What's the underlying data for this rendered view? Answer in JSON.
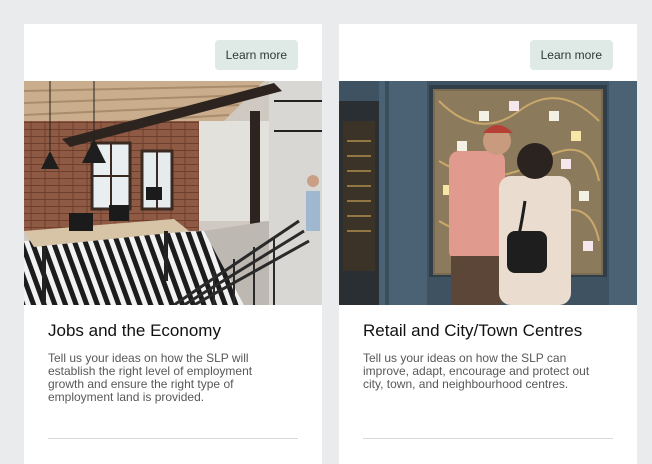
{
  "cards": [
    {
      "button_label": "Learn more",
      "image_subject": "office-interior-photo",
      "title": "Jobs and the Economy",
      "description": "Tell us your ideas on how the SLP will establish the right level of employment growth and ensure the right type of employment land is provided."
    },
    {
      "button_label": "Learn more",
      "image_subject": "couple-at-shop-window-photo",
      "title": "Retail and City/Town Centres",
      "description": "Tell us your ideas on how the SLP can improve, adapt, encourage and protect out city, town, and neighbourhood centres."
    }
  ],
  "colors": {
    "page_background": "#e9ebec",
    "card_background": "#ffffff",
    "button_background": "#dfe9e6"
  }
}
